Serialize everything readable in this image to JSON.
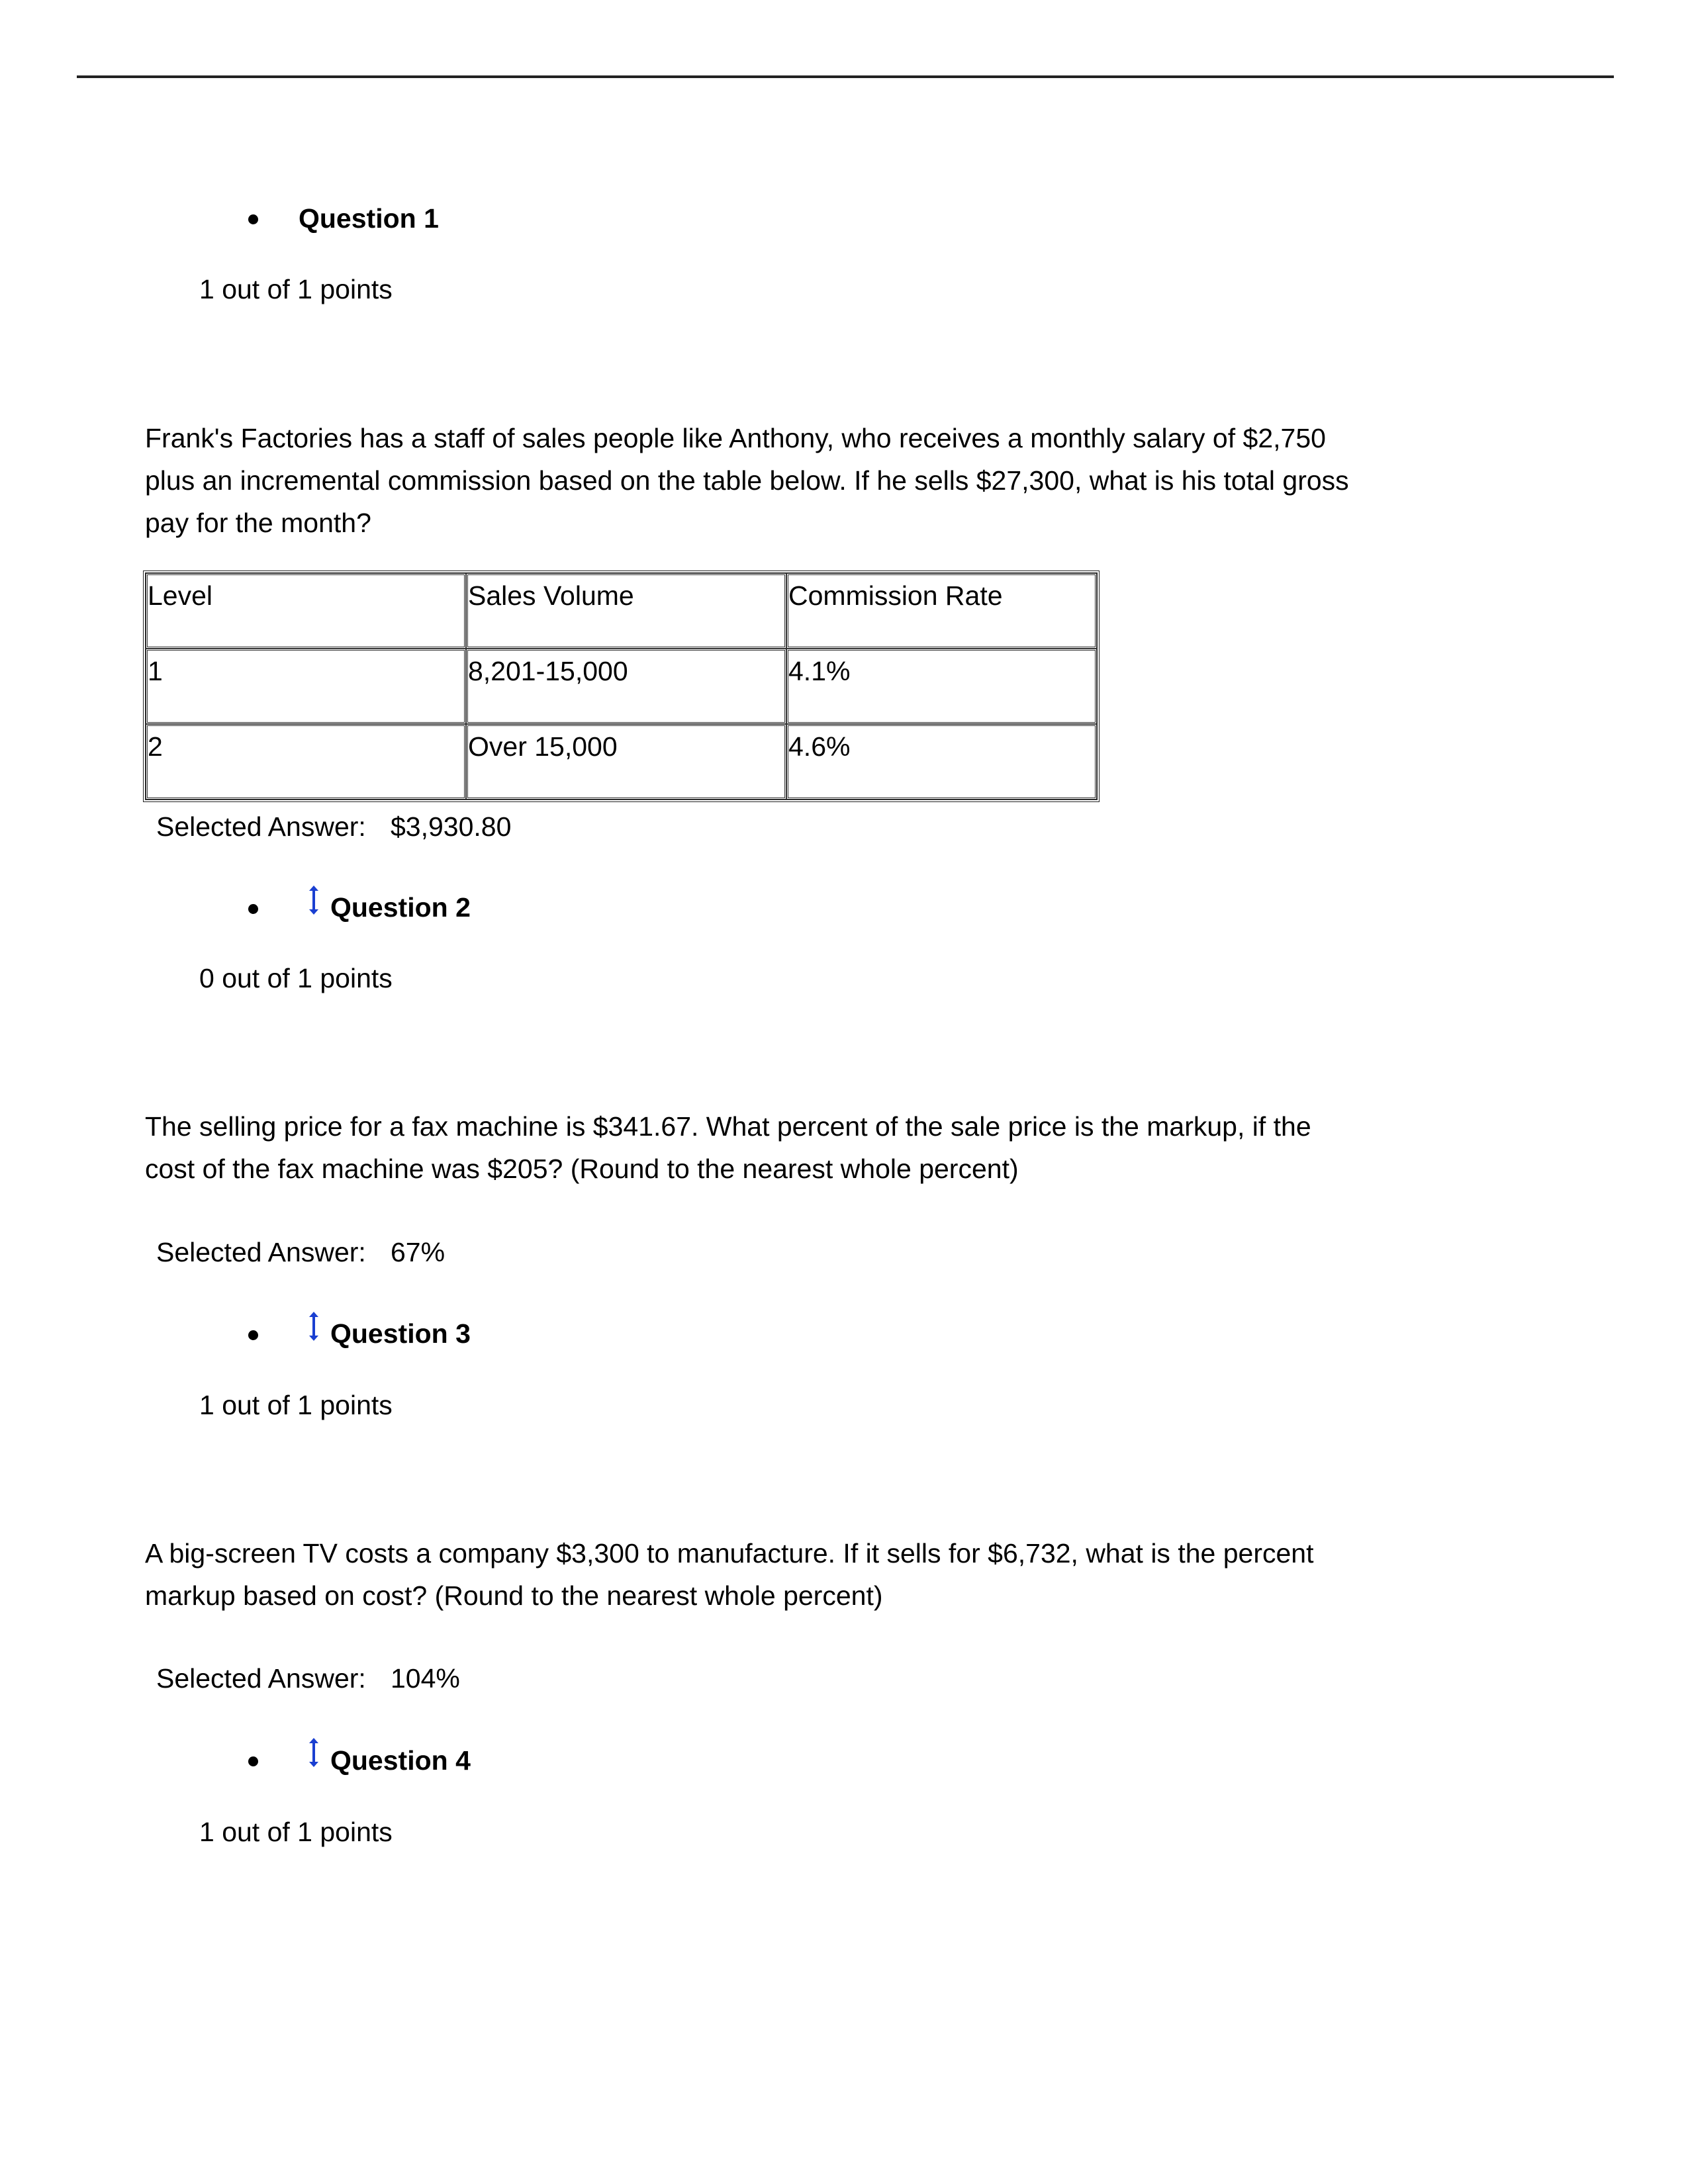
{
  "questions": [
    {
      "label": "Question 1",
      "has_drag_icon": false,
      "score": "1 out of 1 points",
      "text_lines": [
        "Frank's Factories has a staff of sales people like Anthony, who receives a monthly salary of $2,750",
        "plus an incremental commission based on the table below. If he sells $27,300, what is his total gross",
        "pay for the month?"
      ],
      "table": {
        "headers": [
          "Level",
          "Sales Volume",
          "Commission Rate"
        ],
        "rows": [
          [
            "1",
            "8,201-15,000",
            "4.1%"
          ],
          [
            "2",
            "Over 15,000",
            "4.6%"
          ]
        ]
      },
      "selected_answer_label": "Selected Answer:",
      "selected_answer_value": "$3,930.80"
    },
    {
      "label": "Question 2",
      "has_drag_icon": true,
      "score": "0 out of 1 points",
      "text_lines": [
        "The selling price for a fax machine is $341.67. What percent of the sale price is the markup, if the",
        "cost of the fax machine was $205? (Round to the nearest whole percent)"
      ],
      "selected_answer_label": "Selected Answer:",
      "selected_answer_value": "67%"
    },
    {
      "label": "Question 3",
      "has_drag_icon": true,
      "score": "1 out of 1 points",
      "text_lines": [
        "A big-screen TV costs a company $3,300 to manufacture. If it sells for $6,732, what is the percent",
        "markup based on cost? (Round to the nearest whole percent)"
      ],
      "selected_answer_label": "Selected Answer:",
      "selected_answer_value": "104%"
    },
    {
      "label": "Question 4",
      "has_drag_icon": true,
      "score": "1 out of 1 points"
    }
  ],
  "icons": {
    "drag_handle": "vertical-double-arrow-icon",
    "drag_handle_color": "#1a3fd1"
  }
}
